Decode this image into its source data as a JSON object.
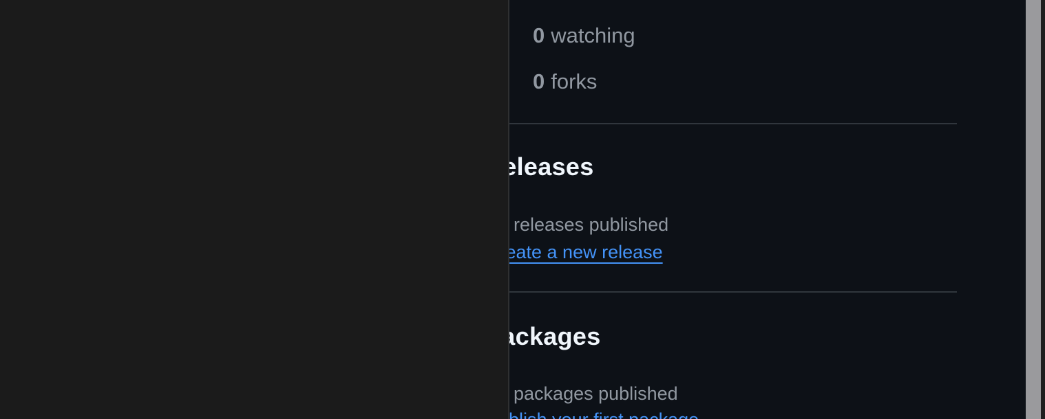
{
  "stats": {
    "watching": {
      "count": "0",
      "label": "watching",
      "icon": "eye-icon"
    },
    "forks": {
      "count": "0",
      "label": "forks",
      "icon": "repo-forked-icon"
    }
  },
  "releases": {
    "title": "Releases",
    "empty_text": "No releases published",
    "link_text": "Create a new release"
  },
  "packages": {
    "title": "Packages",
    "empty_text": "No packages published",
    "link_text": "Publish your first package"
  },
  "colors": {
    "background": "#0d1117",
    "left_panel": "#1b1b1b",
    "text_primary": "#f0f6fc",
    "text_muted": "#9198a1",
    "link": "#4493f8",
    "divider": "#30363d",
    "scrollbar_thumb": "#9a9a9d"
  }
}
